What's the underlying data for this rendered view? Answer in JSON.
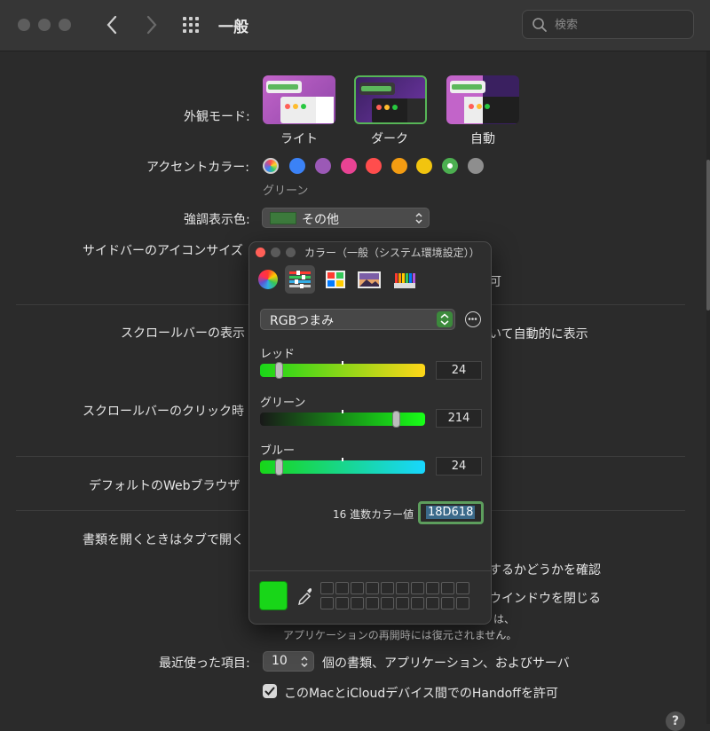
{
  "window": {
    "title": "一般",
    "search_placeholder": "検索"
  },
  "appearance": {
    "label": "外観モード:",
    "options": [
      "ライト",
      "ダーク",
      "自動"
    ],
    "selected": "ダーク"
  },
  "accent": {
    "label": "アクセントカラー:",
    "selected_name": "グリーン",
    "colors": [
      "#3b82f6",
      "#9b59b6",
      "#e84393",
      "#ff4d4d",
      "#f39c12",
      "#f1c40f",
      "#4caf50",
      "#8e8e8e"
    ]
  },
  "highlight": {
    "label": "強調表示色:",
    "value": "その他"
  },
  "sidebar_icon": {
    "label": "サイドバーのアイコンサイズ",
    "partial_right": "可"
  },
  "scrollbar_display": {
    "label": "スクロールバーの表示",
    "partial_right": "いて自動的に表示"
  },
  "scrollbar_click": {
    "label": "スクロールバーのクリック時"
  },
  "browser": {
    "label": "デフォルトのWebブラウザ"
  },
  "tabs": {
    "label": "書類を開くときはタブで開く",
    "partial_confirm": "するかどうかを確認",
    "partial_close": "ウインドウを閉じる",
    "partial_restore_end": "は、",
    "restore_note": "アプリケーションの再開時には復元されません。"
  },
  "recent": {
    "label": "最近使った項目:",
    "value": "10",
    "suffix": "個の書類、アプリケーション、およびサーバ"
  },
  "handoff": {
    "label": "このMacとiCloudデバイス間でのHandoffを許可",
    "checked": true
  },
  "help_label": "?",
  "color_panel": {
    "title": "カラー（一般（システム環境設定））",
    "mode": "RGBつまみ",
    "sliders": [
      {
        "label": "レッド",
        "value": "24",
        "fraction": 0.094
      },
      {
        "label": "グリーン",
        "value": "214",
        "fraction": 0.839
      },
      {
        "label": "ブルー",
        "value": "24",
        "fraction": 0.094
      }
    ],
    "hex_label": "16 進数カラー値",
    "hex_value": "18D618",
    "current_color": "#18D618"
  }
}
